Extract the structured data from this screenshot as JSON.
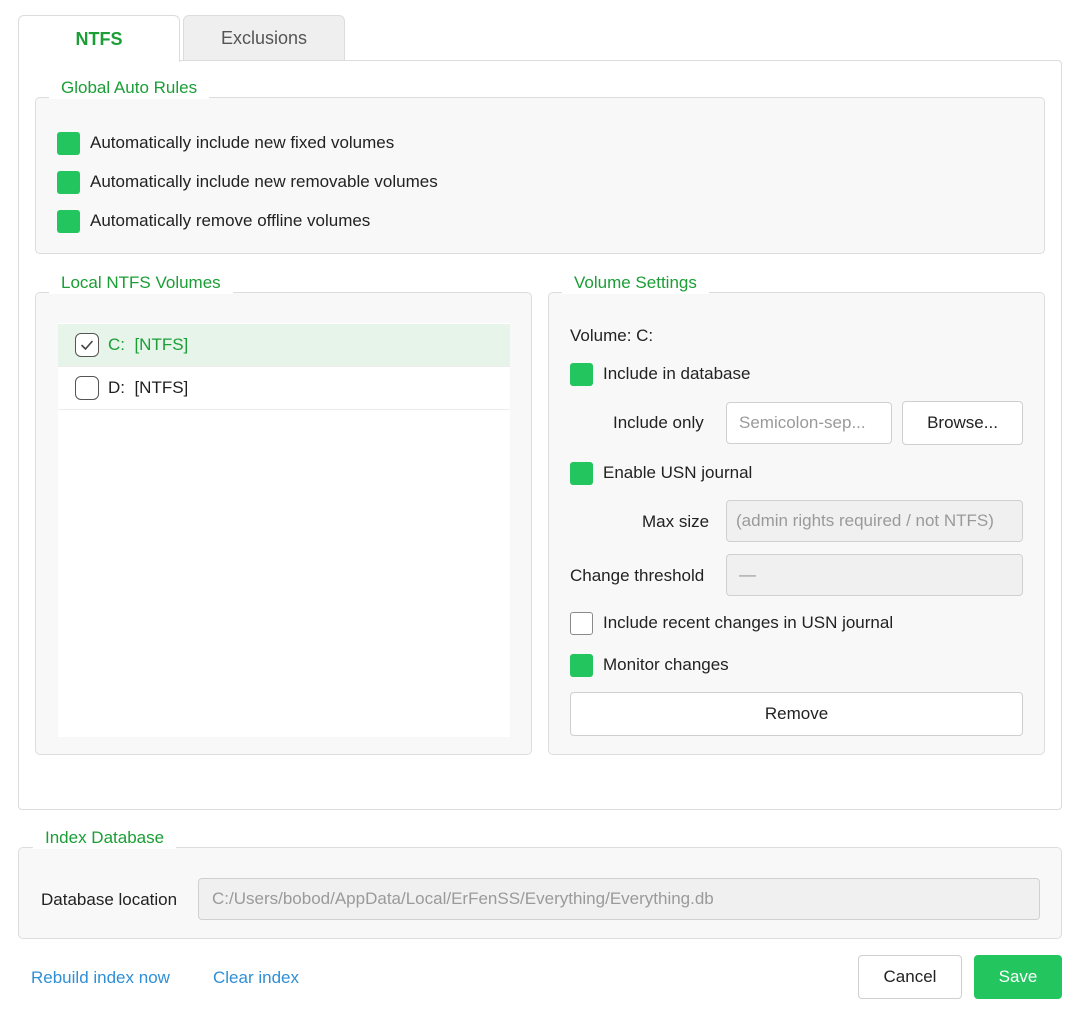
{
  "tabs": [
    {
      "label": "NTFS",
      "active": true
    },
    {
      "label": "Exclusions",
      "active": false
    }
  ],
  "global_auto_rules": {
    "title": "Global Auto Rules",
    "options": [
      {
        "label": "Automatically include new fixed volumes",
        "checked": true
      },
      {
        "label": "Automatically include new removable volumes",
        "checked": true
      },
      {
        "label": "Automatically remove offline volumes",
        "checked": true
      }
    ]
  },
  "local_volumes": {
    "title": "Local NTFS Volumes",
    "items": [
      {
        "label": "C:  [NTFS]",
        "checked": true,
        "selected": true
      },
      {
        "label": "D:  [NTFS]",
        "checked": false,
        "selected": false
      }
    ]
  },
  "volume_settings": {
    "title": "Volume Settings",
    "volume_label": "Volume: C:",
    "include_in_database": {
      "label": "Include in database",
      "checked": true
    },
    "include_only": {
      "label": "Include only",
      "placeholder": "Semicolon-sep...",
      "browse_label": "Browse..."
    },
    "enable_usn": {
      "label": "Enable USN journal",
      "checked": true
    },
    "max_size": {
      "label": "Max size",
      "value": "(admin rights required / not NTFS)"
    },
    "change_threshold": {
      "label": "Change threshold",
      "value": "—"
    },
    "include_recent": {
      "label": "Include recent changes in USN journal",
      "checked": false
    },
    "monitor_changes": {
      "label": "Monitor changes",
      "checked": true
    },
    "remove_label": "Remove"
  },
  "index_database": {
    "title": "Index Database",
    "location_label": "Database location",
    "location_value": "C:/Users/bobod/AppData/Local/ErFenSS/Everything/Everything.db"
  },
  "footer": {
    "rebuild_label": "Rebuild index now",
    "clear_label": "Clear index",
    "cancel_label": "Cancel",
    "save_label": "Save"
  },
  "colors": {
    "accent": "#22c55e",
    "accent_text": "#1a9e35",
    "link": "#2f8fd6",
    "selected_row": "#e6f4ea"
  }
}
